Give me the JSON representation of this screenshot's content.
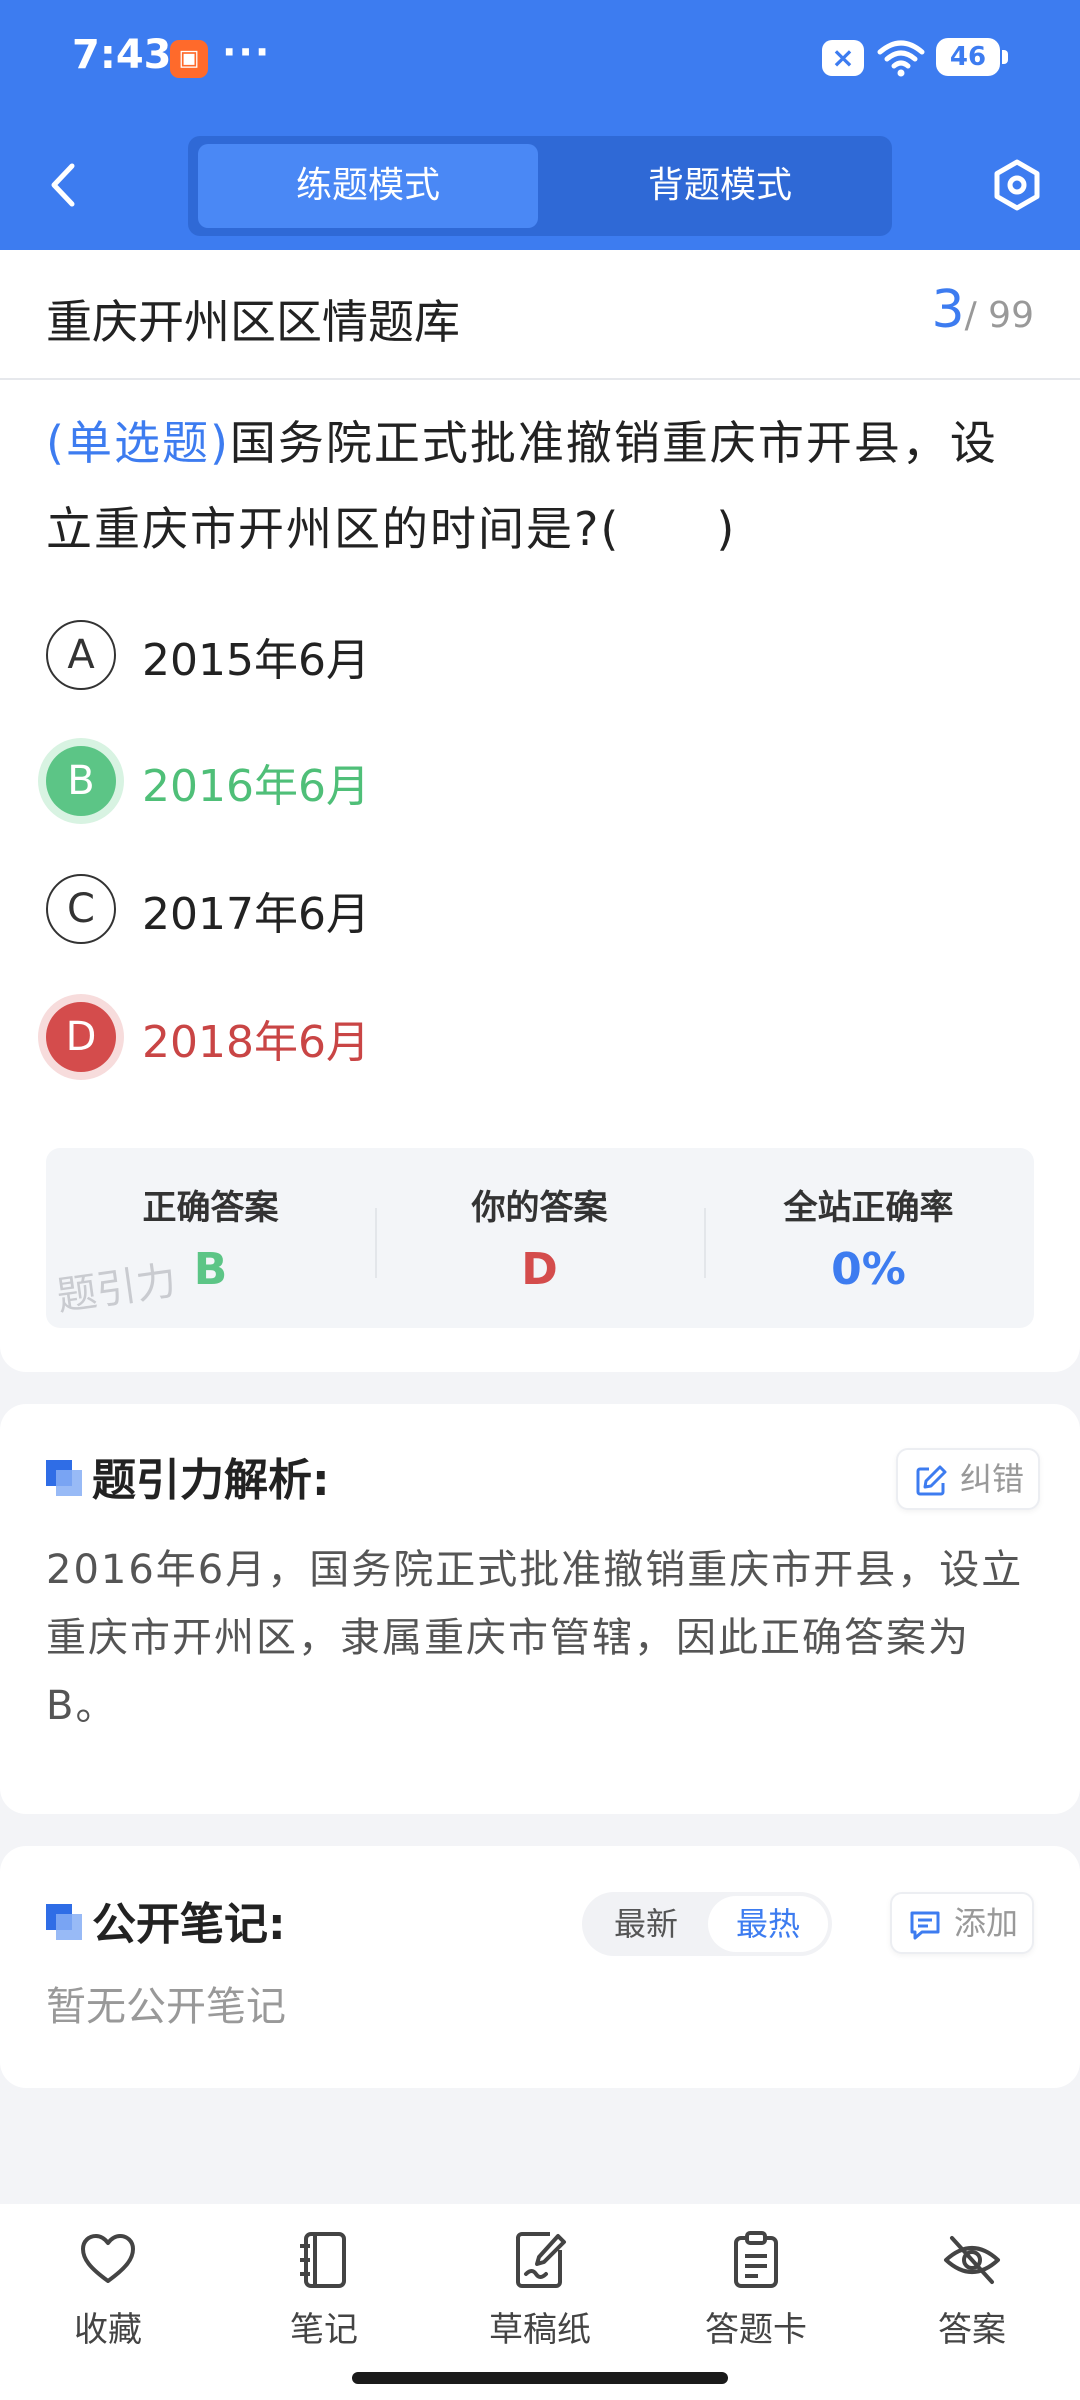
{
  "status_bar": {
    "time": "7:43",
    "more": "···",
    "battery": "46"
  },
  "header": {
    "modes": [
      {
        "label": "练题模式",
        "active": true
      },
      {
        "label": "背题模式",
        "active": false
      }
    ]
  },
  "question_bank": {
    "title": "重庆开州区区情题库",
    "current": "3",
    "total": "/ 99"
  },
  "question": {
    "type": "(单选题)",
    "text": "国务院正式批准撤销重庆市开县，设立重庆市开州区的时间是?(　　)",
    "options": [
      {
        "letter": "A",
        "text": "2015年6月",
        "state": "normal"
      },
      {
        "letter": "B",
        "text": "2016年6月",
        "state": "correct"
      },
      {
        "letter": "C",
        "text": "2017年6月",
        "state": "normal"
      },
      {
        "letter": "D",
        "text": "2018年6月",
        "state": "wrong"
      }
    ]
  },
  "answer_summary": {
    "correct_label": "正确答案",
    "correct_value": "B",
    "yours_label": "你的答案",
    "yours_value": "D",
    "rate_label": "全站正确率",
    "rate_value": "0%",
    "watermark": "题引力"
  },
  "analysis": {
    "title": "题引力解析:",
    "correct_button": "纠错",
    "text": "2016年6月，国务院正式批准撤销重庆市开县，设立重庆市开州区，隶属重庆市管辖，因此正确答案为B。"
  },
  "notes": {
    "title": "公开笔记:",
    "sort_new": "最新",
    "sort_hot": "最热",
    "add_button": "添加",
    "empty": "暂无公开笔记"
  },
  "bottom_nav": [
    {
      "label": "收藏",
      "icon": "heart-icon"
    },
    {
      "label": "笔记",
      "icon": "notebook-icon"
    },
    {
      "label": "草稿纸",
      "icon": "draft-paper-icon"
    },
    {
      "label": "答题卡",
      "icon": "answer-card-icon"
    },
    {
      "label": "答案",
      "icon": "eye-off-icon"
    }
  ],
  "colors": {
    "primary": "#3d7cf0",
    "correct": "#5cc586",
    "wrong": "#d44c4c"
  }
}
